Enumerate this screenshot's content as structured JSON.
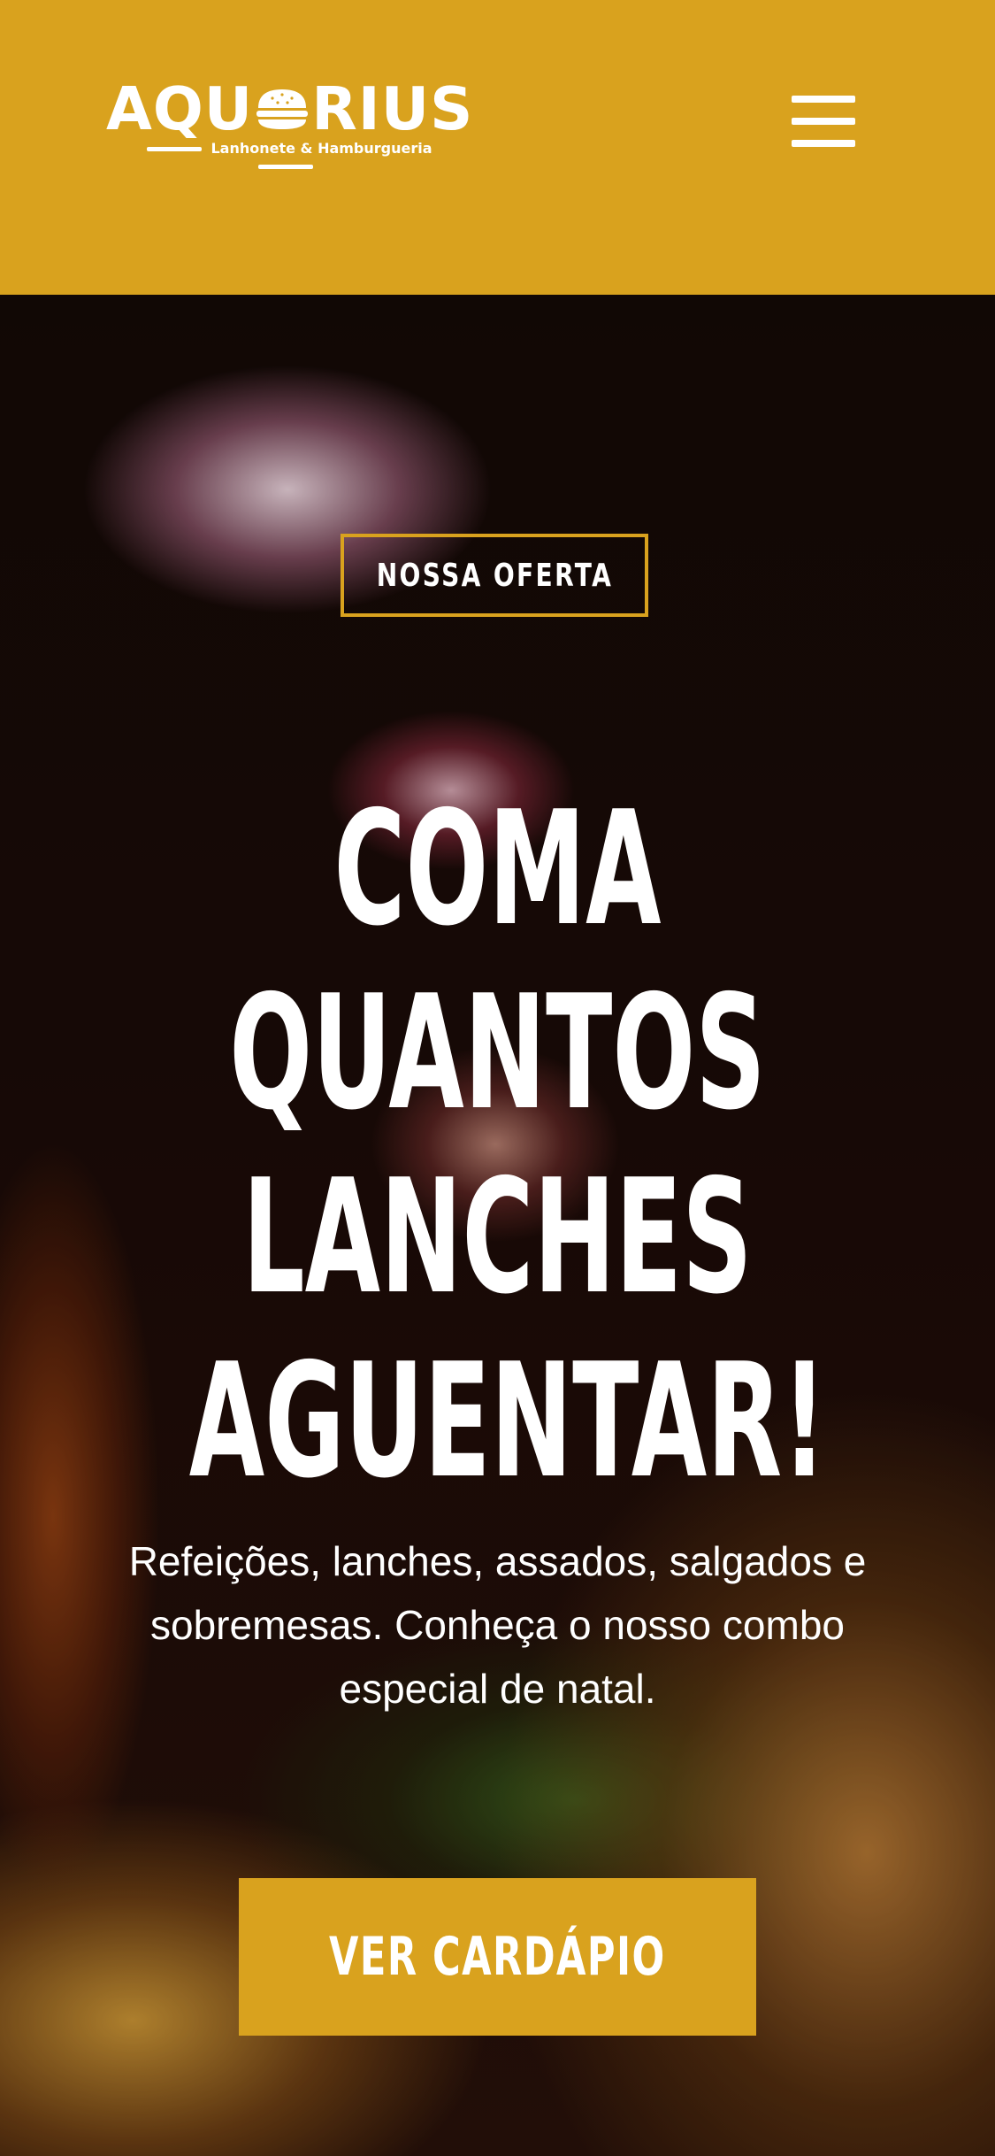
{
  "header": {
    "logo_prefix": "AQU",
    "logo_suffix": "RIUS",
    "logo_tagline": "Lanhonete & Hamburgueria",
    "menu_icon": "hamburger-menu-icon"
  },
  "hero": {
    "offer_tag": "NOSSA OFERTA",
    "headline_lines": [
      "COMA",
      "QUANTOS",
      "LANCHES",
      "AGUENTAR!"
    ],
    "description": "Refeições, lanches, assados, salgados e sobremesas. Conheça o nosso combo especial de natal.",
    "cta_label": "VER CARDÁPIO",
    "background_image": "burger-fries-beer-photo"
  },
  "colors": {
    "accent": "#d9a21e",
    "text": "#ffffff",
    "background": "#1a0c08"
  }
}
